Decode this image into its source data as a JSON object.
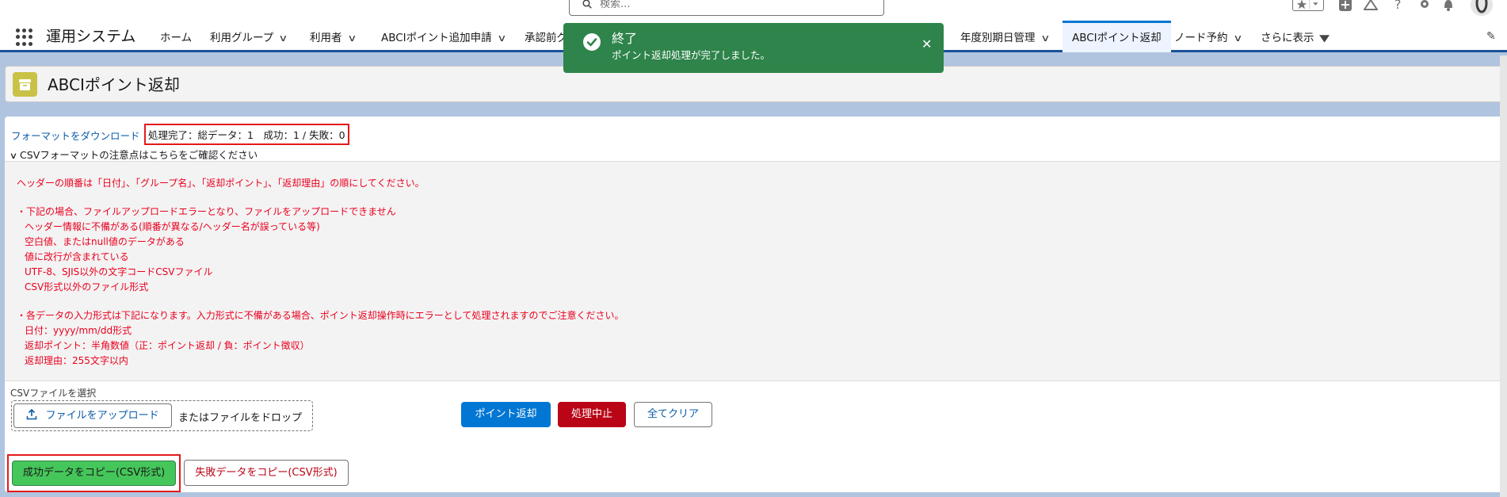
{
  "topbar": {
    "search_placeholder": "検索..."
  },
  "app": {
    "name": "運用システム"
  },
  "nav": {
    "items": [
      {
        "label": "ホーム",
        "chevron": false
      },
      {
        "label": "利用グループ",
        "chevron": true
      },
      {
        "label": "利用者",
        "chevron": true
      },
      {
        "label": "ABCIポイント追加申請",
        "chevron": true
      },
      {
        "label": "承認前グ",
        "chevron": false
      }
    ],
    "right_items": [
      {
        "label": "年度別期日管理",
        "chevron": true
      },
      {
        "label": "ABCIポイント返却",
        "active": true
      },
      {
        "label": "ノード予約",
        "chevron": true
      },
      {
        "label": "さらに表示",
        "chevron": true
      }
    ]
  },
  "page": {
    "title": "ABCIポイント返却"
  },
  "status": {
    "download_link": "フォーマットをダウンロード",
    "result_text": "処理完了：総データ：1　成功：1 / 失敗：0",
    "notes_toggle": "CSVフォーマットの注意点はこちらをご確認ください"
  },
  "notes": {
    "header_order": "ヘッダーの順番は「日付」、「グループ名」、「返却ポイント」、「返却理由」の順にしてください。",
    "error_title": "・下記の場合、ファイルアップロードエラーとなり、ファイルをアップロードできません",
    "error_items": [
      "ヘッダー情報に不備がある(順番が異なる/ヘッダー名が誤っている等)",
      "空白値、またはnull値のデータがある",
      "値に改行が含まれている",
      "UTF-8、SJIS以外の文字コードCSVファイル",
      "CSV形式以外のファイル形式"
    ],
    "format_title": "・各データの入力形式は下記になります。入力形式に不備がある場合、ポイント返却操作時にエラーとして処理されますのでご注意ください。",
    "format_items": [
      "日付：yyyy/mm/dd形式",
      "返却ポイント：半角数値（正：ポイント返却 / 負：ポイント徴収）",
      "返却理由：255文字以内"
    ]
  },
  "upload": {
    "label": "CSVファイルを選択",
    "button": "ファイルをアップロード",
    "drop_text": "またはファイルをドロップ"
  },
  "actions": {
    "return_points": "ポイント返却",
    "abort": "処理中止",
    "clear_all": "全てクリア",
    "copy_success": "成功データをコピー(CSV形式)",
    "copy_failure": "失敗データをコピー(CSV形式)"
  },
  "toast": {
    "title": "終了",
    "message": "ポイント返却処理が完了しました。"
  },
  "colors": {
    "brand": "#0176d3",
    "danger": "#ba0517",
    "success_toast": "#2e844a",
    "success_button": "#45c65a",
    "notice_text": "#ea001e",
    "highlight_border": "#e31a1a"
  }
}
